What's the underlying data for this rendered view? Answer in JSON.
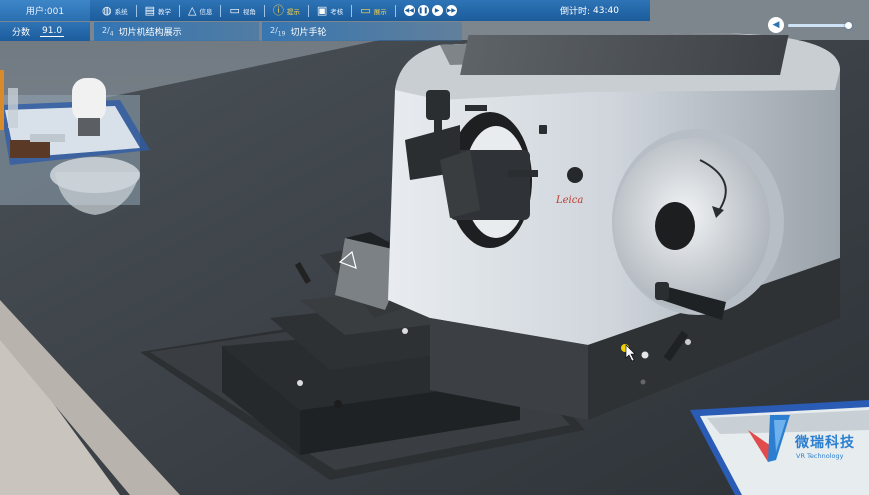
{
  "toolbar": {
    "user": "用户:001",
    "items": [
      {
        "label": "系统",
        "icon": "globe-icon"
      },
      {
        "label": "教学",
        "icon": "teaching-icon"
      },
      {
        "label": "信息",
        "icon": "warning-icon"
      },
      {
        "label": "视角",
        "icon": "image-icon"
      },
      {
        "label": "提示",
        "icon": "question-icon"
      },
      {
        "label": "考核",
        "icon": "clipboard-icon"
      },
      {
        "label": "展示",
        "icon": "monitor-icon"
      }
    ],
    "media": [
      "rewind-icon",
      "pause-icon",
      "play-icon",
      "fast-forward-icon"
    ],
    "countdown_label": "倒计时:",
    "countdown_value": "43:40"
  },
  "score": {
    "label": "分数",
    "value": "91.0"
  },
  "steps": [
    {
      "current": "2",
      "total": "4",
      "title": "切片机结构展示"
    },
    {
      "current": "2",
      "total": "19",
      "title": "切片手轮"
    }
  ],
  "audio": {
    "icon": "speaker-icon"
  },
  "logo": {
    "cn": "微瑞科技",
    "en": "VR Technology"
  },
  "colors": {
    "toolbar": "#2e74b6",
    "highlight": "#ffd84a",
    "logo": "#2c7fd0"
  }
}
